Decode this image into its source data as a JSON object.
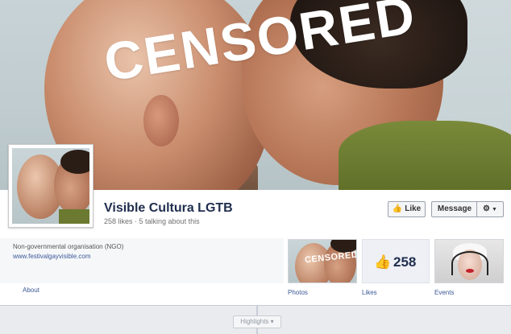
{
  "cover": {
    "overlay_text": "CENSORED"
  },
  "page": {
    "name": "Visible Cultura LGTB",
    "stats": "258 likes · 5 talking about this",
    "category": "Non-governmental organisation (NGO)",
    "website": "www.festivalgayvisible.com"
  },
  "actions": {
    "like_label": "Like",
    "like_icon": "thumbs-up-icon",
    "message_label": "Message",
    "settings_icon": "gear-icon"
  },
  "tiles": {
    "about_label": "About",
    "photos_label": "Photos",
    "photos_overlay": "CENSORED",
    "likes_label": "Likes",
    "likes_count": "258",
    "events_label": "Events"
  },
  "timeline": {
    "highlights_label": "Highlights"
  },
  "colors": {
    "brand_blue": "#3b5998",
    "page_name": "#1f2d4d"
  }
}
